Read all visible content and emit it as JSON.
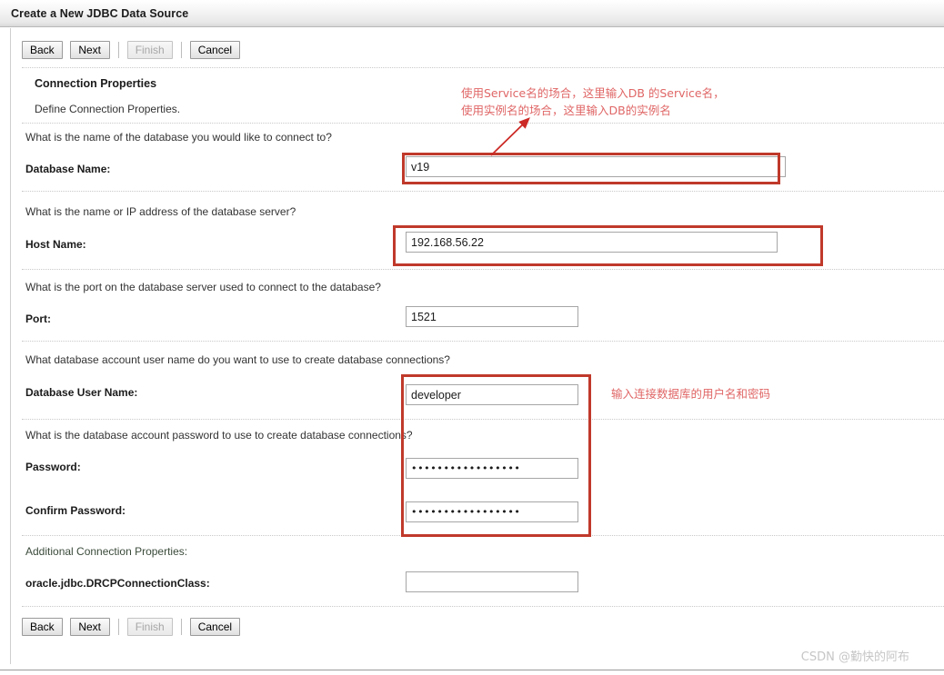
{
  "window": {
    "title": "Create a New JDBC Data Source"
  },
  "toolbar": {
    "back_label": "Back",
    "next_label": "Next",
    "finish_label": "Finish",
    "cancel_label": "Cancel"
  },
  "section": {
    "title": "Connection Properties",
    "subtitle": "Define Connection Properties."
  },
  "fields": [
    {
      "question": "What is the name of the database you would like to connect to?",
      "label": "Database Name:",
      "value": "v19",
      "type": "text"
    },
    {
      "question": "What is the name or IP address of the database server?",
      "label": "Host Name:",
      "value": "192.168.56.22",
      "type": "text"
    },
    {
      "question": "What is the port on the database server used to connect to the database?",
      "label": "Port:",
      "value": "1521",
      "type": "text"
    },
    {
      "question": "What database account user name do you want to use to create database connections?",
      "label": "Database User Name:",
      "value": "developer",
      "type": "text"
    },
    {
      "question": "What is the database account password to use to create database connections?",
      "label": "Password:",
      "value": "•••••••••••••••••",
      "type": "password"
    },
    {
      "question": "",
      "label": "Confirm Password:",
      "value": "•••••••••••••••••",
      "type": "password"
    }
  ],
  "additional": {
    "heading": "Additional Connection Properties:",
    "label": "oracle.jdbc.DRCPConnectionClass:",
    "value": ""
  },
  "annotations": [
    {
      "id": "database-name-note",
      "line1": "使用Service名的场合，这里输入DB 的Service名，",
      "line2": "使用实例名的场合，这里输入DB的实例名"
    },
    {
      "id": "credentials-note",
      "line1": "输入连接数据库的用户名和密码"
    }
  ],
  "watermark": "CSDN @勤快的阿布",
  "colors": {
    "annotation_red": "#e06666",
    "highlight_red": "#c0392b",
    "title_bar_border": "#b9b9b9"
  }
}
